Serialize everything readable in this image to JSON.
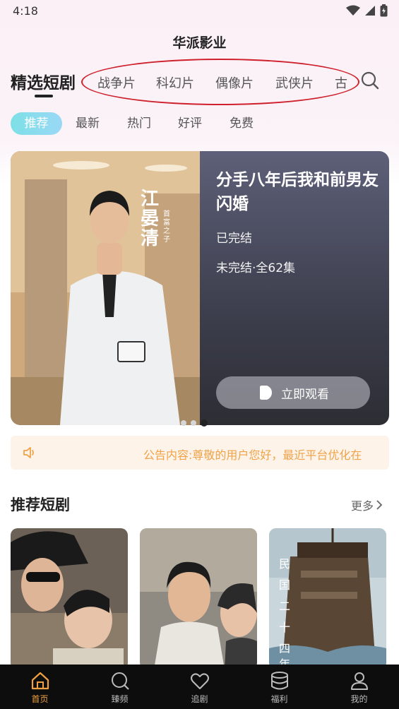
{
  "status_bar": {
    "time": "4:18"
  },
  "app": {
    "title": "华派影业"
  },
  "header": {
    "title": "精选短剧",
    "categories": [
      "战争片",
      "科幻片",
      "偶像片",
      "武侠片",
      "古"
    ]
  },
  "filters": [
    "推荐",
    "最新",
    "热门",
    "好评",
    "免费"
  ],
  "banner": {
    "title": "分手八年后我和前男友闪婚",
    "status": "已完结",
    "episodes": "未完结·全62集",
    "watch_label": "立即观看",
    "poster_name": "江晏清",
    "poster_caption": "首富之子",
    "page_count": 3,
    "active_page": 3
  },
  "notice": {
    "text": "公告内容:尊敬的用户您好，最近平台优化在"
  },
  "recommend": {
    "title": "推荐短剧",
    "more_label": "更多",
    "card3_text": [
      "民",
      "国",
      "二",
      "十",
      "四",
      "年"
    ]
  },
  "tab_bar": {
    "items": [
      {
        "label": "首页",
        "icon": "home-icon",
        "active": true
      },
      {
        "label": "臻频",
        "icon": "search-icon",
        "active": false
      },
      {
        "label": "追剧",
        "icon": "heart-icon",
        "active": false
      },
      {
        "label": "福利",
        "icon": "database-icon",
        "active": false
      },
      {
        "label": "我的",
        "icon": "user-icon",
        "active": false
      }
    ]
  },
  "colors": {
    "accent": "#f0a040",
    "highlight_ellipse": "#d0202c",
    "chip_active": "#7de0e6",
    "notice_text": "#f0a34a"
  }
}
